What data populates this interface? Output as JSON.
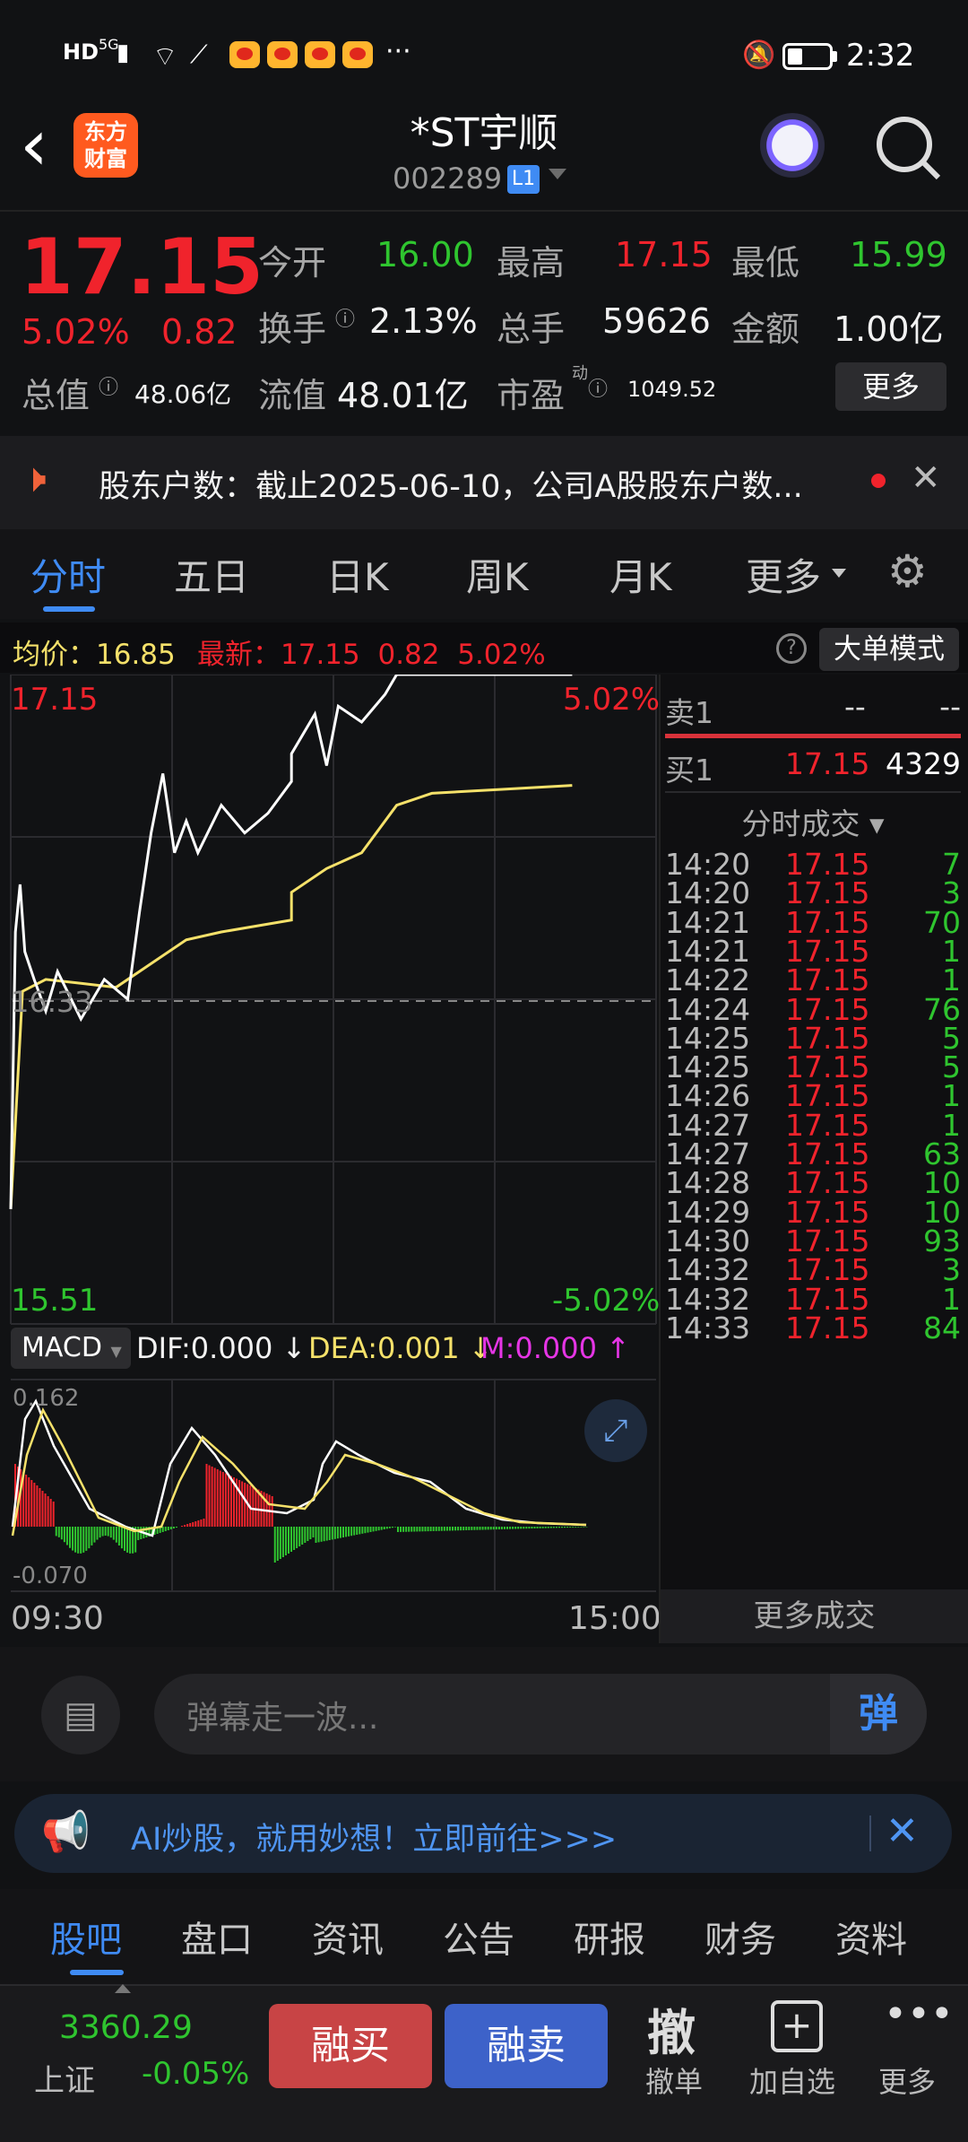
{
  "status": {
    "time": "2:32",
    "network": "5G",
    "hd": "HD",
    "more": "···"
  },
  "nav": {
    "back": "‹",
    "logo": "东方\n财富",
    "title": "*ST宇顺",
    "code": "002289",
    "level": "L1"
  },
  "quote": {
    "price": "17.15",
    "change_pct": "5.02%",
    "change": "0.82",
    "open_label": "今开",
    "open": "16.00",
    "high_label": "最高",
    "high": "17.15",
    "low_label": "最低",
    "low": "15.99",
    "turnover_label": "换手",
    "turnover": "2.13%",
    "volume_label": "总手",
    "volume": "59626",
    "amount_label": "金额",
    "amount": "1.00亿",
    "mktcap_label": "总值",
    "mktcap": "48.06亿",
    "float_label": "流值",
    "float": "48.01亿",
    "pe_label": "市盈",
    "pe_sup": "动",
    "pe": "1049.52",
    "more_button": "更多"
  },
  "notice": {
    "text": "股东户数：截止2025-06-10，公司A股股东户数..."
  },
  "tabs": [
    "分时",
    "五日",
    "日K",
    "周K",
    "月K",
    "更多"
  ],
  "chart_header": {
    "avg_label": "均价：",
    "avg": "16.85",
    "latest_label": "最新：",
    "latest": "17.15",
    "latest_chg": "0.82",
    "latest_pct": "5.02%",
    "big_order_button": "大单模式"
  },
  "chart_labels": {
    "top_price": "17.15",
    "top_pct": "5.02%",
    "mid_price": "16.33",
    "bottom_price": "15.51",
    "bottom_pct": "-5.02%",
    "x_start": "09:30",
    "x_end": "15:00"
  },
  "macd": {
    "selector": "MACD",
    "dif": "DIF:0.000",
    "dea": "DEA:0.001",
    "m": "M:0.000",
    "top": "0.162",
    "bottom": "-0.070"
  },
  "chart_data": {
    "type": "line",
    "ylim": [
      15.51,
      17.15
    ],
    "x_range": [
      "09:30",
      "15:00"
    ],
    "series": [
      {
        "name": "最新",
        "color": "#ffffff",
        "x": [
          "09:30",
          "09:32",
          "09:34",
          "09:36",
          "09:40",
          "09:45",
          "09:50",
          "10:00",
          "10:10",
          "10:20",
          "10:25",
          "10:30",
          "10:35",
          "10:40",
          "10:45",
          "10:50",
          "11:00",
          "11:10",
          "11:20",
          "11:30",
          "13:00",
          "13:10",
          "13:15",
          "13:20",
          "13:30",
          "13:40",
          "13:45",
          "14:00",
          "14:30",
          "15:00"
        ],
        "y": [
          15.8,
          16.5,
          16.62,
          16.45,
          16.38,
          16.3,
          16.4,
          16.28,
          16.38,
          16.33,
          16.55,
          16.75,
          16.9,
          16.7,
          16.78,
          16.7,
          16.82,
          16.75,
          16.8,
          16.88,
          16.95,
          17.05,
          16.92,
          17.07,
          17.03,
          17.1,
          17.15,
          17.15,
          17.15,
          17.15
        ]
      },
      {
        "name": "均价",
        "color": "#f5e16a",
        "x": [
          "09:30",
          "09:35",
          "09:45",
          "10:00",
          "10:15",
          "10:30",
          "10:45",
          "11:00",
          "11:30",
          "13:00",
          "13:15",
          "13:30",
          "13:45",
          "14:00",
          "14:30",
          "15:00"
        ],
        "y": [
          15.8,
          16.35,
          16.38,
          16.37,
          16.36,
          16.42,
          16.48,
          16.5,
          16.53,
          16.6,
          16.66,
          16.7,
          16.82,
          16.85,
          16.86,
          16.87
        ]
      }
    ]
  },
  "order_book": {
    "sell_label": "卖1",
    "sell_price": "--",
    "sell_vol": "--",
    "buy_label": "买1",
    "buy_price": "17.15",
    "buy_vol": "4329"
  },
  "trades_header": "分时成交 ▾",
  "trades": [
    {
      "time": "14:20",
      "price": "17.15",
      "vol": "7"
    },
    {
      "time": "14:20",
      "price": "17.15",
      "vol": "3"
    },
    {
      "time": "14:21",
      "price": "17.15",
      "vol": "70"
    },
    {
      "time": "14:21",
      "price": "17.15",
      "vol": "1"
    },
    {
      "time": "14:22",
      "price": "17.15",
      "vol": "1"
    },
    {
      "time": "14:24",
      "price": "17.15",
      "vol": "76"
    },
    {
      "time": "14:25",
      "price": "17.15",
      "vol": "5"
    },
    {
      "time": "14:25",
      "price": "17.15",
      "vol": "5"
    },
    {
      "time": "14:26",
      "price": "17.15",
      "vol": "1"
    },
    {
      "time": "14:27",
      "price": "17.15",
      "vol": "1"
    },
    {
      "time": "14:27",
      "price": "17.15",
      "vol": "63"
    },
    {
      "time": "14:28",
      "price": "17.15",
      "vol": "10"
    },
    {
      "time": "14:29",
      "price": "17.15",
      "vol": "10"
    },
    {
      "time": "14:30",
      "price": "17.15",
      "vol": "93"
    },
    {
      "time": "14:32",
      "price": "17.15",
      "vol": "3"
    },
    {
      "time": "14:32",
      "price": "17.15",
      "vol": "1"
    },
    {
      "time": "14:33",
      "price": "17.15",
      "vol": "84"
    }
  ],
  "more_trades": "更多成交",
  "danmaku": {
    "placeholder": "弹幕走一波...",
    "send": "弹"
  },
  "ad": {
    "text": "AI炒股，就用妙想！立即前往>>>"
  },
  "bottom_tabs": [
    "股吧",
    "盘口",
    "资讯",
    "公告",
    "研报",
    "财务",
    "资料"
  ],
  "footer": {
    "index_value": "3360.29",
    "index_name": "上证",
    "index_pct": "-0.05%",
    "buy_button": "融买",
    "sell_button": "融卖",
    "cancel_icon": "撤",
    "cancel_label": "撤单",
    "watch_label": "加自选",
    "more_label": "更多"
  },
  "colors": {
    "up": "#f0232c",
    "down": "#2fc52f",
    "price_line": "#ffffff",
    "avg_line": "#f5e16a",
    "buy_button": "#c84445",
    "sell_button": "#3d62c9",
    "accent_blue": "#3f8bf4"
  }
}
